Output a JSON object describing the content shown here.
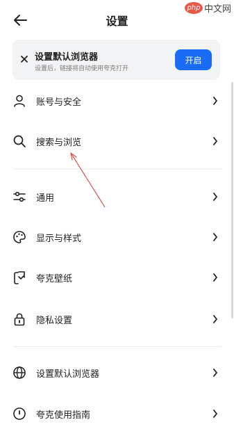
{
  "header": {
    "title": "设置",
    "back_icon": "back-arrow-icon"
  },
  "watermark": {
    "logo_text": "php",
    "text": "中文网"
  },
  "banner": {
    "title": "设置默认浏览器",
    "subtitle": "设置后，链接将自动使用夸克打开",
    "button_label": "开启",
    "button_color": "#1a6cf7"
  },
  "menu": {
    "items": [
      {
        "label": "账号与安全",
        "icon": "user-icon"
      },
      {
        "label": "搜索与浏览",
        "icon": "search-icon"
      },
      {
        "label": "通用",
        "icon": "sliders-icon"
      },
      {
        "label": "显示与样式",
        "icon": "palette-icon"
      },
      {
        "label": "夸克壁纸",
        "icon": "wallpaper-icon"
      },
      {
        "label": "隐私设置",
        "icon": "lock-icon"
      },
      {
        "label": "设置默认浏览器",
        "icon": "globe-icon"
      },
      {
        "label": "夸克使用指南",
        "icon": "guide-icon"
      }
    ]
  },
  "annotation_color": "#d9534f"
}
